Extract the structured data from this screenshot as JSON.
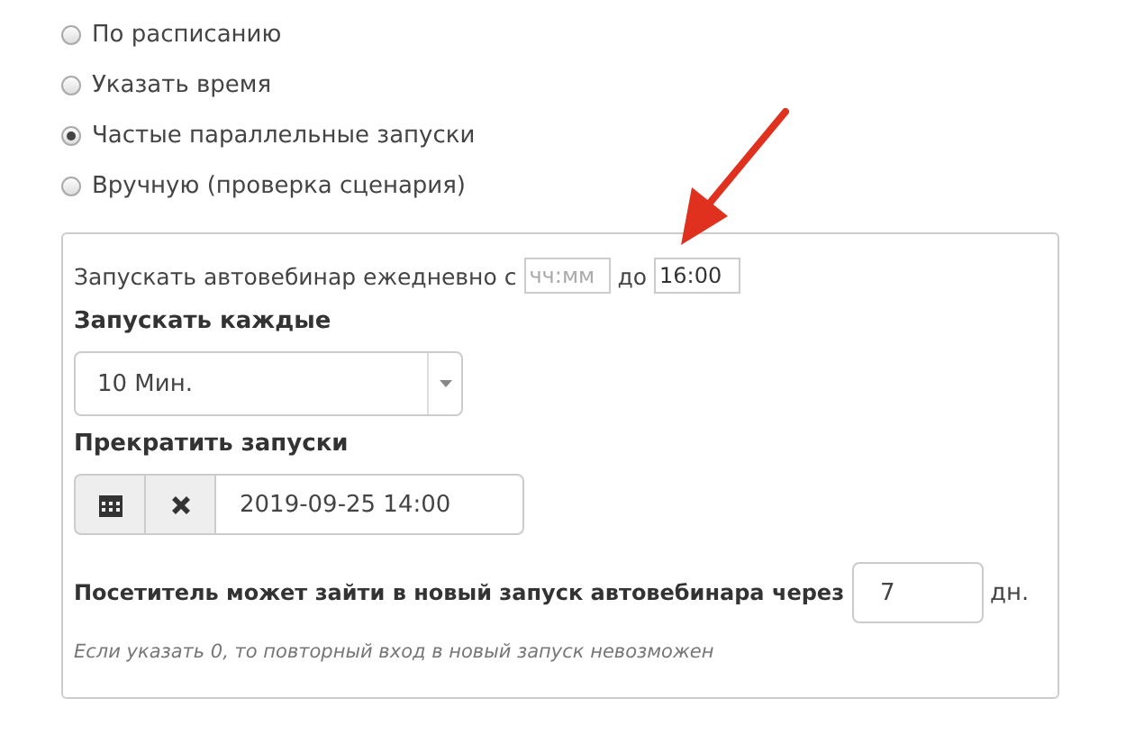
{
  "schedule_options": [
    {
      "label": "По расписанию",
      "selected": false
    },
    {
      "label": "Указать время",
      "selected": false
    },
    {
      "label": "Частые параллельные запуски",
      "selected": true
    },
    {
      "label": "Вручную (проверка сценария)",
      "selected": false
    }
  ],
  "panel": {
    "daily_text": "Запускать автовебинар ежедневно с",
    "from_placeholder": "чч:мм",
    "to_text": "до",
    "to_value": "16:00",
    "interval_label": "Запускать каждые",
    "interval_value": "10 Мин.",
    "stop_label": "Прекратить запуски",
    "stop_value": "2019-09-25 14:00",
    "revisit_label": "Посетитель может зайти в новый запуск автовебинара через",
    "revisit_value": "7",
    "revisit_unit": "дн.",
    "hint": "Если указать 0, то повторный вход в новый запуск невозможен"
  }
}
